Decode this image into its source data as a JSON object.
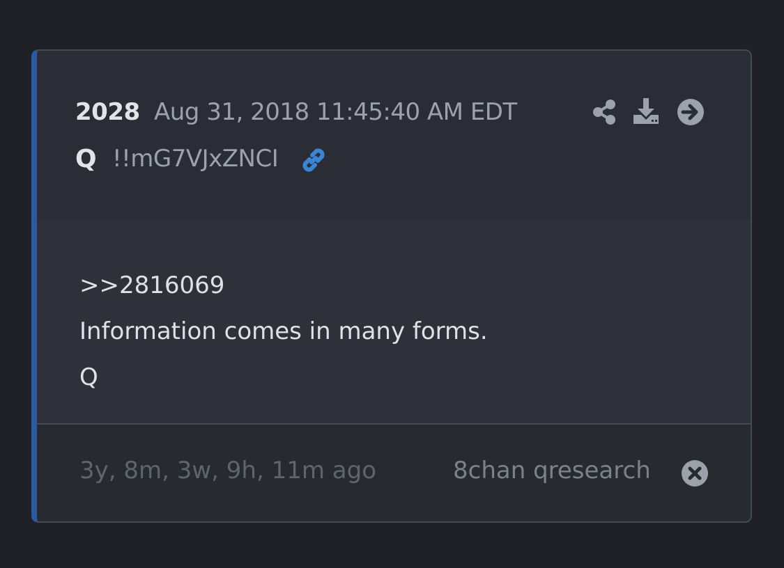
{
  "post": {
    "number": "2028",
    "date": "Aug 31, 2018 11:45:40 AM EDT",
    "author": "Q",
    "tripcode": "!!mG7VJxZNCI"
  },
  "body": {
    "lines": [
      ">>2816069",
      "Information comes in many forms.",
      "Q"
    ]
  },
  "footer": {
    "age": "3y, 8m, 3w, 9h, 11m ago",
    "source": "8chan qresearch"
  },
  "icons": {
    "share": "share-icon",
    "download": "download-icon",
    "next": "arrow-right-circle-icon",
    "link": "link-icon",
    "close": "close-circle-icon"
  },
  "colors": {
    "accent_bar": "#2c5aa0",
    "link": "#3a86d4",
    "icon": "#9ca1aa"
  }
}
